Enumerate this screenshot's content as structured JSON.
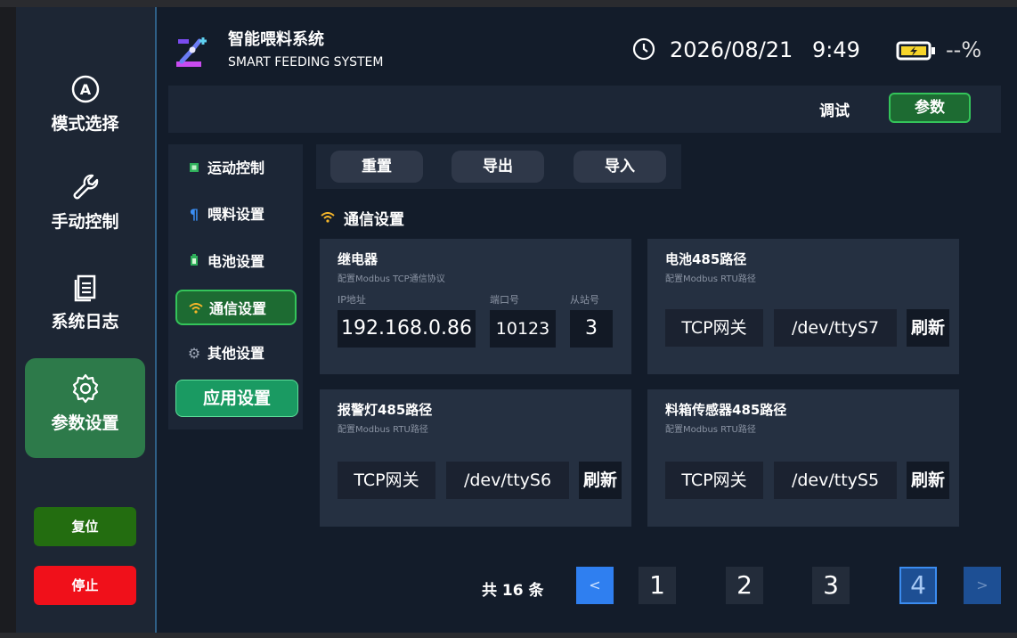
{
  "sidebar": {
    "items": [
      {
        "label": "模式选择",
        "icon": "mode-select-icon"
      },
      {
        "label": "手动控制",
        "icon": "wrench-icon"
      },
      {
        "label": "系统日志",
        "icon": "document-icon"
      },
      {
        "label": "参数设置",
        "icon": "gear-icon",
        "active": true
      }
    ],
    "reset_label": "复位",
    "stop_label": "停止"
  },
  "header": {
    "title": "智能喂料系统",
    "subtitle": "SMART FEEDING SYSTEM",
    "date": "2026/08/21",
    "time": "9:49",
    "battery": "--%"
  },
  "modes": {
    "debug": "调试",
    "param": "参数"
  },
  "submenu": {
    "items": [
      {
        "label": "运动控制",
        "icon": "chip-icon"
      },
      {
        "label": "喂料设置",
        "icon": "utensils-icon"
      },
      {
        "label": "电池设置",
        "icon": "battery-icon"
      },
      {
        "label": "通信设置",
        "icon": "wifi-icon",
        "active": true
      },
      {
        "label": "其他设置",
        "icon": "cog-icon"
      }
    ],
    "apply": "应用设置"
  },
  "toolbar": {
    "reset": "重置",
    "export": "导出",
    "import": "导入"
  },
  "section_title": "通信设置",
  "cards": {
    "relay": {
      "title": "继电器",
      "subtitle": "配置Modbus TCP通信协议",
      "ip_label": "IP地址",
      "port_label": "端口号",
      "slave_label": "从站号",
      "ip": "192.168.0.86",
      "port": "10123",
      "slave": "3"
    },
    "battery485": {
      "title": "电池485路径",
      "subtitle": "配置Modbus RTU路径",
      "gateway": "TCP网关",
      "path": "/dev/ttyS7",
      "refresh": "刷新"
    },
    "alarm485": {
      "title": "报警灯485路径",
      "subtitle": "配置Modbus RTU路径",
      "gateway": "TCP网关",
      "path": "/dev/ttyS6",
      "refresh": "刷新"
    },
    "bin485": {
      "title": "料箱传感器485路径",
      "subtitle": "配置Modbus RTU路径",
      "gateway": "TCP网关",
      "path": "/dev/ttyS5",
      "refresh": "刷新"
    }
  },
  "pager": {
    "total": "共 16 条",
    "prev": "<",
    "next": ">",
    "pages": [
      "1",
      "2",
      "3",
      "4"
    ],
    "current": "4"
  },
  "colors": {
    "accent_green": "#34c45a",
    "stop_red": "#f0101a",
    "pager_blue": "#2f7ff0"
  }
}
